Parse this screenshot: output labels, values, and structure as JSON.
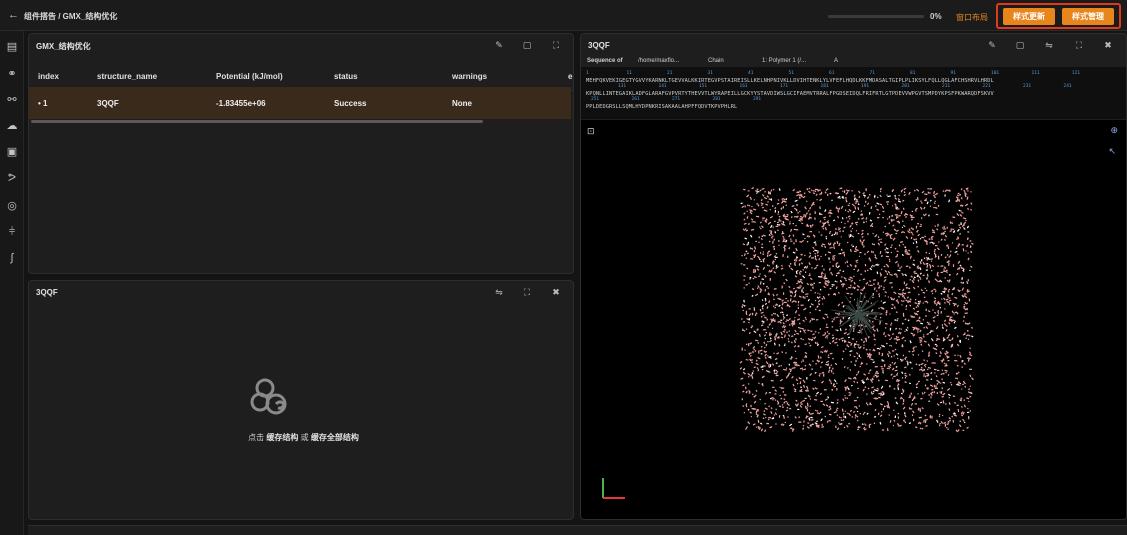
{
  "header": {
    "back_icon": "arrow-left-icon",
    "breadcrumb": "组件搭告 / GMX_结构优化",
    "progress_value": 0,
    "progress_text": "0%",
    "layout_label": "窗口布局",
    "style_update_label": "样式更新",
    "style_manage_label": "样式管理",
    "accent_color": "#e8861e"
  },
  "sidebar": {
    "icons": [
      "grid-icon",
      "molecule-icon",
      "atoms-icon",
      "cloud-icon",
      "image-icon",
      "branch-icon",
      "target-icon",
      "sliders-icon",
      "flow-icon"
    ]
  },
  "table_panel": {
    "title": "GMX_结构优化",
    "columns": [
      "index",
      "structure_name",
      "Potential (kJ/mol)",
      "status",
      "warnings",
      "e"
    ],
    "rows": [
      {
        "index": "• 1",
        "structure_name": "3QQF",
        "potential": "-1.83455e+06",
        "status": "Success",
        "warnings": "None"
      }
    ]
  },
  "empty_panel": {
    "title": "3QQF",
    "message_prefix": "点击",
    "cache_structure": "缓存结构",
    "message_or": "或",
    "cache_all": "缓存全部结构"
  },
  "viewer_panel": {
    "title": "3QQF",
    "sequence_bar": {
      "sequence_of": "Sequence of",
      "path": "/home/maxflo...",
      "chain_label": "Chain",
      "polymer": "1: Polymer 1 (/...",
      "chain_id": "A"
    },
    "sequence_lines": [
      "MEHFQKVEKIGEGTYGVVYKARNKLTGEVVALKKIRTEGVPSTAIREISLLKELNHPNIVKLLDVIHTENKLYLVFEFLHQDLKKFMDASALTGIPLPLIKSYLFQLLQGLAFCHSHRVLHRDL",
      "KPQNLLINTEGAIKLADFGLARAFGVPVRTYTHEVVTLWYRAPEILLGCKYYSTAVDIWSLGCIFAEMVTRRALFPGDSEIDQLFRIFRTLGTPDEVVWPGVTSMPDYKPSFPKWARQDFSKVV",
      "PPLDEDGRSLLSQMLHYDPNKRISAKAALAHPFFQDVTKPVPHLRL"
    ],
    "sequence_numbers_line1": [
      "1",
      "11",
      "21",
      "31",
      "41",
      "51",
      "61",
      "71",
      "81",
      "91",
      "101",
      "111",
      "121"
    ],
    "sequence_numbers_line2": [
      "131",
      "141",
      "151",
      "161",
      "171",
      "181",
      "191",
      "201",
      "211",
      "221",
      "231",
      "241"
    ],
    "sequence_numbers_line3": [
      "251",
      "261",
      "271",
      "281",
      "291"
    ],
    "molecule_color": "#f3a3a0"
  }
}
